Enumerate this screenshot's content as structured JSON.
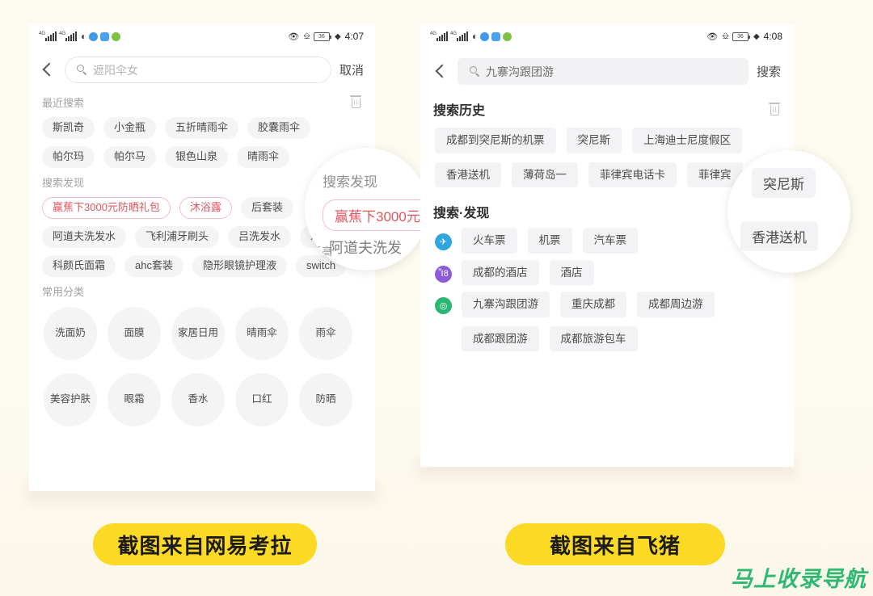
{
  "page": {
    "background_color": "#fdfaf0",
    "watermark": "马上收录导航",
    "watermark_color": "#2eb872"
  },
  "captions": {
    "left": "截图来自网易考拉",
    "right": "截图来自飞猪",
    "color": "#fcd925"
  },
  "left_phone": {
    "statusbar": {
      "network_label_1": "4G",
      "network_label_2": "4G",
      "wifi_icon": "wifi-icon",
      "app_icon_1": "blue-app-icon",
      "app_icon_2": "blue-square-app-icon",
      "app_icon_3": "green-play-icon",
      "eye_icon": "eye-icon",
      "vibrate_icon": "vibrate-icon",
      "battery_level": "36",
      "charging_icon": "charging-bolt-icon",
      "clock": "4:07"
    },
    "search": {
      "back_icon": "back-chevron-icon",
      "search_icon": "search-icon",
      "placeholder": "遮阳伞女",
      "action_label": "取消"
    },
    "recent": {
      "title": "最近搜索",
      "clear_icon": "trash-icon",
      "tags": [
        "斯凯奇",
        "小金瓶",
        "五折晴雨伞",
        "胶囊雨伞",
        "帕尔玛",
        "帕尔马",
        "银色山泉",
        "晴雨伞"
      ]
    },
    "discover": {
      "title": "搜索发现",
      "tags": [
        {
          "label": "赢蕉下3000元防晒礼包",
          "hot": true
        },
        {
          "label": "沐浴露",
          "hot": true
        },
        {
          "label": "后套装",
          "hot": false
        },
        {
          "label": "阿道夫洗发水",
          "hot": false
        },
        {
          "label": "飞利浦牙刷头",
          "hot": false
        },
        {
          "label": "吕洗发水",
          "hot": false
        },
        {
          "label": "乐高",
          "hot": false
        },
        {
          "label": "科颜氏面霜",
          "hot": false
        },
        {
          "label": "ahc套装",
          "hot": false
        },
        {
          "label": "隐形眼镜护理液",
          "hot": false
        },
        {
          "label": "switch",
          "hot": false
        }
      ]
    },
    "categories": {
      "title": "常用分类",
      "items": [
        "洗面奶",
        "面膜",
        "家居\n日用",
        "晴雨伞",
        "雨伞",
        "美容\n护肤",
        "眼霜",
        "香水",
        "口红",
        "防晒"
      ]
    },
    "loupe": {
      "title": "搜索发现",
      "pill": "赢蕉下3000元",
      "ghost_top": "乐高",
      "ghost_bottom": "阿道夫洗发"
    }
  },
  "right_phone": {
    "statusbar": {
      "network_label_1": "4G",
      "network_label_2": "4G",
      "wifi_icon": "wifi-icon",
      "app_icon_1": "blue-app-icon",
      "app_icon_2": "blue-square-app-icon",
      "app_icon_3": "green-play-icon",
      "eye_icon": "eye-icon",
      "vibrate_icon": "vibrate-icon",
      "battery_level": "36",
      "charging_icon": "charging-bolt-icon",
      "clock": "4:08"
    },
    "search": {
      "back_icon": "back-chevron-icon",
      "search_icon": "search-icon",
      "value": "九寨沟跟团游",
      "action_label": "搜索"
    },
    "history": {
      "title": "搜索历史",
      "clear_icon": "trash-icon",
      "tags": [
        "成都到突尼斯的机票",
        "突尼斯",
        "上海迪士尼度假区",
        "香港送机",
        "薄荷岛一",
        "菲律宾电话卡",
        "菲律宾"
      ]
    },
    "discover": {
      "title": "搜索·发现",
      "groups": [
        {
          "icon": "plane-icon",
          "icon_color": "#2ea7e0",
          "tags": [
            "火车票",
            "机票",
            "汽车票"
          ]
        },
        {
          "icon": "hotel-icon",
          "icon_color": "#8b5cd6",
          "tags": [
            "成都的酒店",
            "酒店"
          ]
        },
        {
          "icon": "tour-icon",
          "icon_color": "#2bb673",
          "tags": [
            "九寨沟跟团游",
            "重庆成都",
            "成都周边游",
            "成都跟团游",
            "成都旅游包车"
          ]
        }
      ]
    },
    "loupe": {
      "pill_top": "突尼斯",
      "pill_bottom": "香港送机"
    }
  }
}
